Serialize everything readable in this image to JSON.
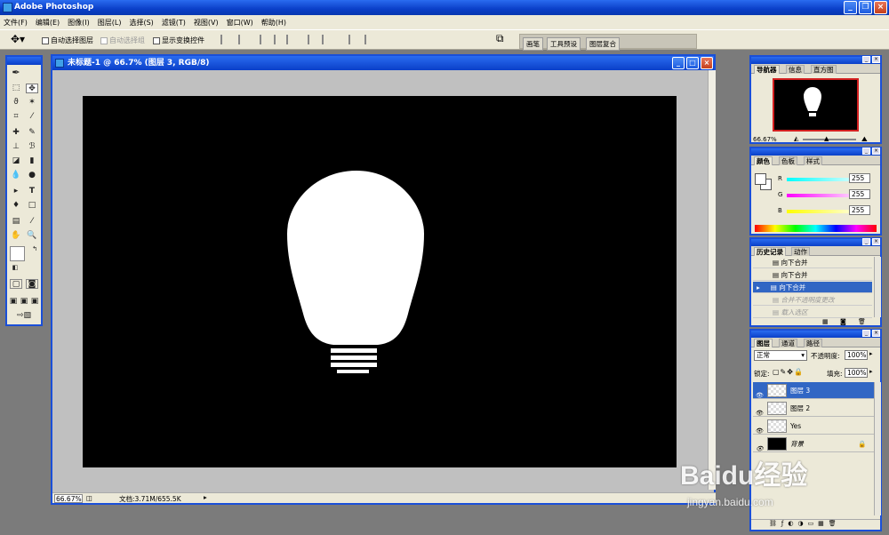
{
  "app": {
    "title": "Adobe Photoshop"
  },
  "menu": [
    "文件(F)",
    "编辑(E)",
    "图像(I)",
    "图层(L)",
    "选择(S)",
    "滤镜(T)",
    "视图(V)",
    "窗口(W)",
    "帮助(H)"
  ],
  "options": {
    "auto_select_layer": "自动选择图层",
    "auto_select_group": "自动选择组",
    "show_transform": "显示变换控件"
  },
  "palette_well": {
    "tabs": [
      "画笔",
      "工具预设",
      "图层复合"
    ]
  },
  "document": {
    "title": "未标题-1 @ 66.7% (图层 3, RGB/8)",
    "zoom": "66.67%",
    "doc_size": "文档:3.71M/655.5K"
  },
  "navigator": {
    "tabs": [
      "导航器",
      "信息",
      "直方图"
    ],
    "zoom": "66.67%"
  },
  "color": {
    "tabs": [
      "颜色",
      "色板",
      "样式"
    ],
    "channels": [
      {
        "label": "R",
        "value": "255"
      },
      {
        "label": "G",
        "value": "255"
      },
      {
        "label": "B",
        "value": "255"
      }
    ]
  },
  "history": {
    "tabs": [
      "历史记录",
      "动作"
    ],
    "items": [
      "向下合并",
      "向下合并",
      "向下合并",
      "合并不透明度更改",
      "载入选区"
    ],
    "selected_index": 2
  },
  "layers": {
    "tabs": [
      "图层",
      "通道",
      "路径"
    ],
    "blend_mode": "正常",
    "opacity_label": "不透明度:",
    "opacity": "100%",
    "lock_label": "锁定:",
    "fill_label": "填充:",
    "fill": "100%",
    "items": [
      "图层 3",
      "图层 2",
      "Yes",
      "背景"
    ],
    "selected_index": 0
  },
  "watermark": {
    "brand": "Baidu经验",
    "url": "jingyan.baidu.com"
  },
  "colors": {
    "titlebar": "#0a3fc8",
    "canvas": "#000000",
    "bulb": "#ffffff",
    "selection": "#3166c4"
  }
}
